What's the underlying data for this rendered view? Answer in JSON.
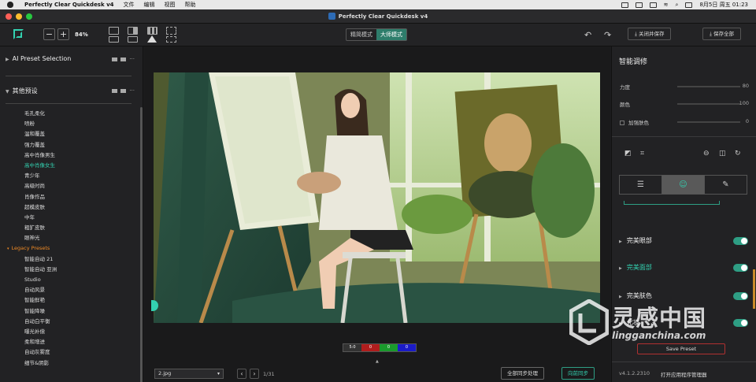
{
  "menubar": {
    "app_name": "Perfectly Clear Quickdesk v4",
    "items": [
      "文件",
      "编辑",
      "视图",
      "帮助"
    ],
    "clock": "8月5日 周五  01:23"
  },
  "window": {
    "title": "Perfectly Clear Quickdesk v4"
  },
  "toolbar": {
    "zoom_minus": "−",
    "zoom_plus": "+",
    "zoom": "84%",
    "mode_simple": "精简模式",
    "mode_master": "大师模式",
    "undo": "↶",
    "redo": "↷",
    "close_save": "⤓ 关闭并保存",
    "save_all": "⤓ 保存全部"
  },
  "left_panel": {
    "ai_preset": "AI Preset Selection",
    "other_presets": "其他预设",
    "presets": [
      {
        "label": "毛孔柔化",
        "type": "item"
      },
      {
        "label": "喷粉",
        "type": "item"
      },
      {
        "label": "温和覆盖",
        "type": "item"
      },
      {
        "label": "强力覆盖",
        "type": "item"
      },
      {
        "label": "高中肖像男生",
        "type": "item"
      },
      {
        "label": "高中肖像女生",
        "type": "selected"
      },
      {
        "label": "青少年",
        "type": "item"
      },
      {
        "label": "高级时尚",
        "type": "item"
      },
      {
        "label": "肖像作品",
        "type": "item"
      },
      {
        "label": "超模皮肤",
        "type": "item"
      },
      {
        "label": "中年",
        "type": "item"
      },
      {
        "label": "粗犷皮肤",
        "type": "item"
      },
      {
        "label": "眼神光",
        "type": "item"
      },
      {
        "label": "Legacy Presets",
        "type": "group"
      },
      {
        "label": "智能自动 21",
        "type": "item"
      },
      {
        "label": "智能自动 亚洲",
        "type": "item"
      },
      {
        "label": "Studio",
        "type": "item"
      },
      {
        "label": "自动风景",
        "type": "item"
      },
      {
        "label": "智能鲜艳",
        "type": "item"
      },
      {
        "label": "智能降噪",
        "type": "item"
      },
      {
        "label": "自动白平衡",
        "type": "item"
      },
      {
        "label": "曝光补偿",
        "type": "item"
      },
      {
        "label": "柔和增进",
        "type": "item"
      },
      {
        "label": "自动灰雾度",
        "type": "item"
      },
      {
        "label": "细节&阴影",
        "type": "item"
      }
    ]
  },
  "center": {
    "histogram": {
      "w": "5:0",
      "r": "0",
      "g": "0",
      "b": "0"
    },
    "file": "2.jpg",
    "prev": "‹",
    "next": "›",
    "pager": "1/31",
    "sync_all": "全部同步处理",
    "sync_forward": "向前同步"
  },
  "right_panel": {
    "title": "智能调修",
    "sliders": [
      {
        "label": "力度",
        "value": "80"
      },
      {
        "label": "颜色",
        "value": "100"
      },
      {
        "label": "加强肤色",
        "value": "0"
      }
    ],
    "sections": [
      {
        "label": "完美眼部"
      },
      {
        "label": "完美面部"
      },
      {
        "label": "完美肤色"
      },
      {
        "label": "化妆"
      }
    ],
    "save_preset": "Save Preset",
    "version": "v4.1.2.2310",
    "plugin_manager": "打开应用程序管理器"
  },
  "watermark": {
    "cn": "灵感中国",
    "en": "lingganchina.com"
  },
  "colors": {
    "accent": "#33d1b0",
    "legacy": "#f08a24",
    "toggle": "#2e9e84"
  }
}
